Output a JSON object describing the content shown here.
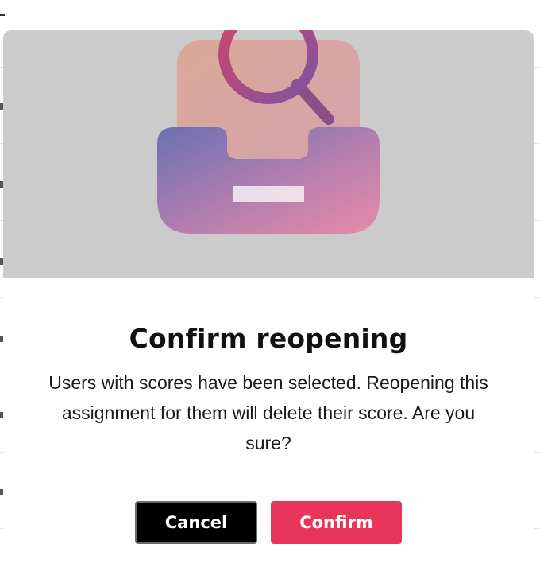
{
  "dialog": {
    "title": "Confirm reopening",
    "message": "Users with scores have been selected. Reopening this assignment for them will delete their score. Are you sure?",
    "cancel_label": "Cancel",
    "confirm_label": "Confirm",
    "illustration_icon": "inbox-search-icon"
  },
  "colors": {
    "confirm_button": "#e8365a",
    "cancel_button": "#000000",
    "hero_background": "#cbcbcb",
    "gradient_start": "#6b6fb4",
    "gradient_end": "#e88ba7",
    "magnifier": "#c8476f"
  }
}
